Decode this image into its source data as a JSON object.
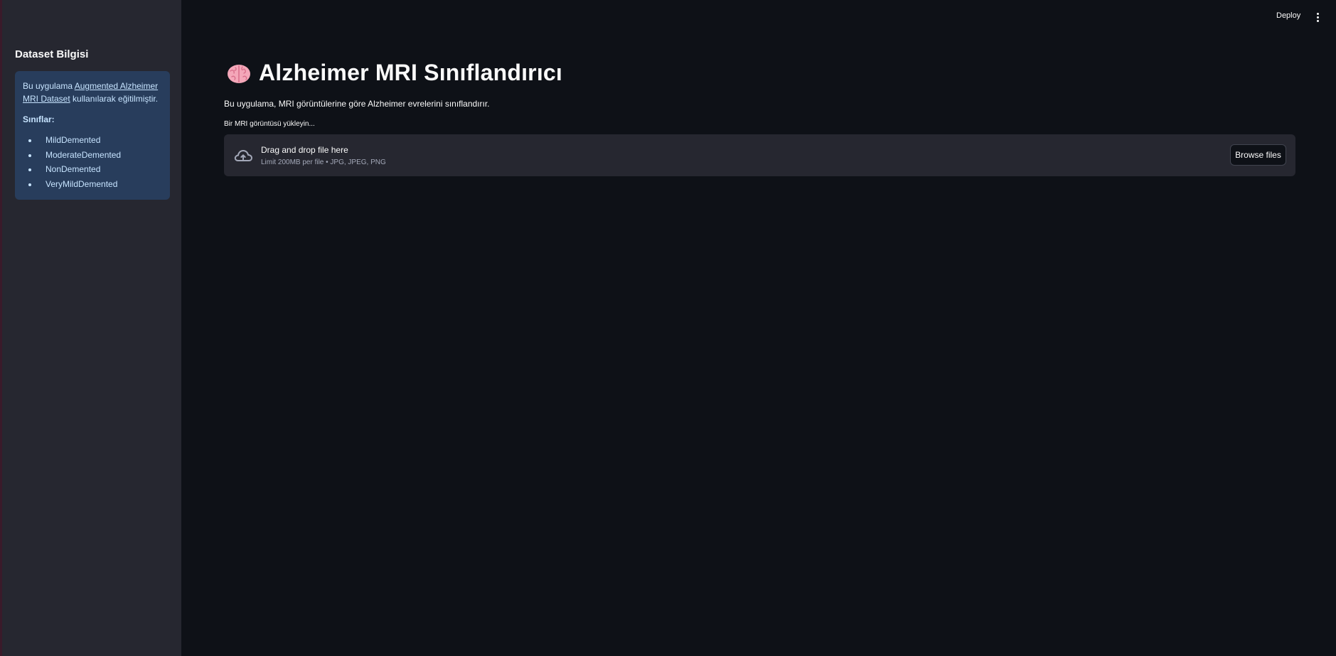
{
  "header": {
    "deploy_label": "Deploy",
    "menu_icon": "kebab-menu-icon"
  },
  "sidebar": {
    "title": "Dataset Bilgisi",
    "info": {
      "text_before": "Bu uygulama ",
      "link_text": "Augmented Alzheimer MRI Dataset",
      "text_after": " kullanılarak eğitilmiştir.",
      "classes_title": "Sınıflar:",
      "classes": [
        "MildDemented",
        "ModerateDemented",
        "NonDemented",
        "VeryMildDemented"
      ]
    }
  },
  "main": {
    "title_icon": "brain-icon",
    "title": "Alzheimer MRI Sınıflandırıcı",
    "description": "Bu uygulama, MRI görüntülerine göre Alzheimer evrelerini sınıflandırır.",
    "uploader": {
      "label": "Bir MRI görüntüsü yükleyin...",
      "icon": "cloud-upload-icon",
      "instructions": "Drag and drop file here",
      "limits": "Limit 200MB per file • JPG, JPEG, PNG",
      "browse_label": "Browse files"
    }
  },
  "colors": {
    "background": "#0e1117",
    "sidebar": "#262730",
    "info_box": "#283d5c",
    "info_text": "#c7e4ff"
  }
}
